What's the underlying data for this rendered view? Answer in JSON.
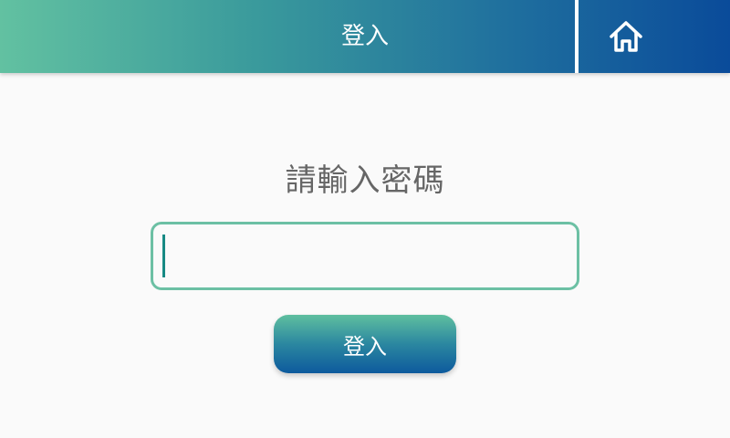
{
  "header": {
    "title": "登入",
    "home_icon": "home-icon"
  },
  "main": {
    "prompt": "請輸入密碼",
    "password_value": "",
    "login_label": "登入"
  },
  "colors": {
    "accent_teal": "#62c1a1",
    "accent_blue": "#0a4b9a"
  }
}
